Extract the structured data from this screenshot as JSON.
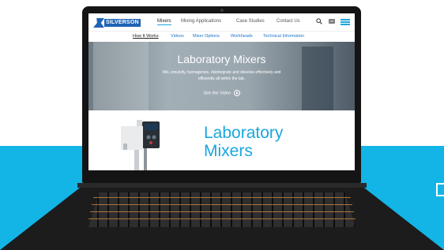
{
  "site": {
    "logo_text": "SILVERSON",
    "nav": [
      {
        "label": "Mixers",
        "active": true
      },
      {
        "label": "Mixing Applications",
        "active": false
      },
      {
        "label": "Case Studies",
        "active": false
      },
      {
        "label": "Contact Us",
        "active": false
      }
    ],
    "lang_code": "UK",
    "subnav": [
      {
        "label": "How It Works",
        "active": true
      },
      {
        "label": "Videos",
        "active": false
      },
      {
        "label": "Mixer Options",
        "active": false
      },
      {
        "label": "Workheads",
        "active": false
      },
      {
        "label": "Technical Information",
        "active": false
      }
    ],
    "hero": {
      "title": "Laboratory Mixers",
      "subtitle": "Mix, emulsify, homogenize, disintegrate and dissolve effectively and efficiently all within the lab.",
      "video_link": "See the Video"
    },
    "content_title_line1": "Laboratory",
    "content_title_line2": "Mixers"
  },
  "colors": {
    "accent": "#1aa7dd",
    "brand": "#1f64b6",
    "background_band": "#13b4e6",
    "keyboard_backlight": "#c2813c"
  }
}
